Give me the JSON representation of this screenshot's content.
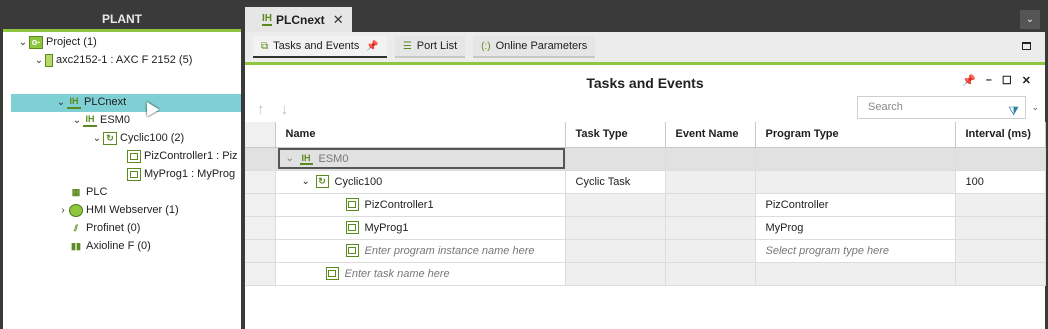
{
  "plant": {
    "title": "PLANT",
    "tree": [
      {
        "label": "Project (1)",
        "toggle": "⌄",
        "icon": "project-folder-icon"
      },
      {
        "label": "axc2152-1 : AXC F 2152 (5)",
        "toggle": "⌄",
        "icon": "controller-device-icon"
      },
      {
        "label": "PLCnext",
        "toggle": "⌄",
        "icon": "plcnext-icon",
        "selected": true
      },
      {
        "label": "ESM0",
        "toggle": "⌄",
        "icon": "esm-icon"
      },
      {
        "label": "Cyclic100 (2)",
        "toggle": "⌄",
        "icon": "cyclic-task-icon"
      },
      {
        "label": "PizController1 : Piz",
        "toggle": "",
        "icon": "program-instance-icon"
      },
      {
        "label": "MyProg1 : MyProg",
        "toggle": "",
        "icon": "program-instance-icon"
      },
      {
        "label": "PLC",
        "toggle": "",
        "icon": "plc-icon"
      },
      {
        "label": "HMI Webserver (1)",
        "toggle": "›",
        "icon": "hmi-globe-icon"
      },
      {
        "label": "Profinet (0)",
        "toggle": "",
        "icon": "profinet-icon"
      },
      {
        "label": "Axioline F (0)",
        "toggle": "",
        "icon": "axioline-icon"
      }
    ]
  },
  "doc": {
    "tab_label": "PLCnext",
    "tab_close": "✕",
    "menu_chevron": "⌄",
    "subtabs": [
      {
        "label": "Tasks and Events",
        "pin": "📌"
      },
      {
        "label": "Port List"
      },
      {
        "label": "Online Parameters"
      }
    ],
    "editor_title": "Tasks and Events",
    "win_controls": [
      "📌",
      "–",
      "☐",
      "✕"
    ],
    "nav_arrows": "↑ ↓",
    "more_glyph": "⌄",
    "search_placeholder": "Search",
    "columns": [
      "Name",
      "Task Type",
      "Event Name",
      "Program Type",
      "Interval (ms)"
    ],
    "rows": [
      {
        "name": "ESM0",
        "task_type": "",
        "event_name": "",
        "program_type": "",
        "interval": ""
      },
      {
        "name": "Cyclic100",
        "task_type": "Cyclic Task",
        "event_name": "",
        "program_type": "",
        "interval": "100"
      },
      {
        "name": "PizController1",
        "task_type": "",
        "event_name": "",
        "program_type": "PizController",
        "interval": ""
      },
      {
        "name": "MyProg1",
        "task_type": "",
        "event_name": "",
        "program_type": "MyProg",
        "interval": ""
      },
      {
        "name": "Enter program instance name here",
        "task_type": "",
        "event_name": "",
        "program_type": "Select program type here",
        "interval": ""
      },
      {
        "name": "Enter task name here",
        "task_type": "",
        "event_name": "",
        "program_type": "",
        "interval": ""
      }
    ]
  },
  "colors": {
    "accent": "#8ec63f",
    "selection": "#7fd0d4",
    "dark": "#3a3a3a"
  }
}
